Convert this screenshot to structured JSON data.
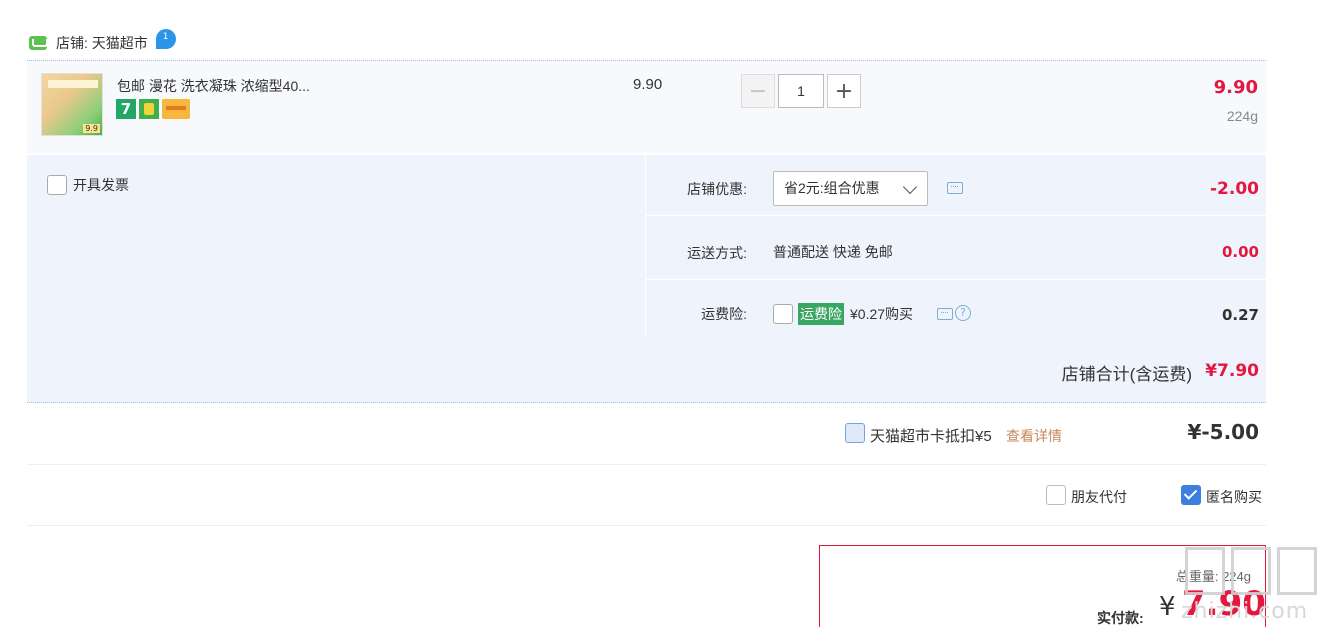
{
  "store": {
    "label": "店铺: 天猫超市"
  },
  "item": {
    "title": "包邮 漫花 洗衣凝珠 浓缩型40...",
    "badge_text": "7",
    "unit_price": "9.90",
    "quantity": "1",
    "minus_symbol": "−",
    "plus_symbol": "+",
    "total": "9.90",
    "weight": "224g"
  },
  "invoice": {
    "label": "开具发票"
  },
  "order": {
    "discount_label": "店铺优惠:",
    "discount_selected": "省2元:组合优惠",
    "discount_amount": "-2.00",
    "shipping_label": "运送方式:",
    "shipping_value": "普通配送 快递 免邮",
    "shipping_amount": "0.00",
    "insurance_label": "运费险:",
    "insurance_tag": "运费险",
    "insurance_price": "¥0.27购买",
    "insurance_amount": "0.27"
  },
  "store_total": {
    "label": "店铺合计(含运费)",
    "value": "¥7.90"
  },
  "card": {
    "label": "天猫超市卡抵扣¥5",
    "link": "查看详情",
    "amount": "¥-5.00"
  },
  "payment": {
    "friend_label": "朋友代付",
    "anonymous_label": "匿名购买",
    "anonymous_checked": true
  },
  "summary": {
    "weight_text": "总重量: 224g",
    "paid_label": "实付款:",
    "currency": "¥",
    "amount": "7.90"
  },
  "watermark": {
    "text": "zhizhi.com"
  },
  "colors": {
    "price_red": "#e4173f",
    "panel_bg": "#eef3fc",
    "accent_blue": "#3d7fe0",
    "link_orange": "#c8885a"
  },
  "icons": [
    "store-icon",
    "wangwang-icon",
    "chevron-down-icon",
    "message-icon",
    "help-icon",
    "checkmark-icon"
  ]
}
